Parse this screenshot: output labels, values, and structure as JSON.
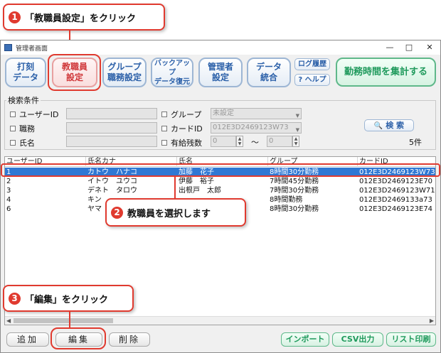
{
  "window": {
    "title": "管理者画面",
    "controls": [
      "—",
      "□",
      "✕"
    ]
  },
  "toolbar": {
    "clock_line1": "打刻",
    "clock_line2": "データ",
    "staff_line1": "教職員",
    "staff_line2": "設定",
    "group_line1": "グループ",
    "group_line2": "職務設定",
    "backup_line1": "バックアップ",
    "backup_line2": "データ復元",
    "admin_line1": "管理者",
    "admin_line2": "設定",
    "data_line1": "データ",
    "data_line2": "統合",
    "log_label": "ログ履歴",
    "help_label": "? ヘルプ",
    "aggregate_label": "勤務時間を集計する"
  },
  "search": {
    "legend": "検索条件",
    "user_id_label": "ユーザーID",
    "position_label": "職務",
    "name_label": "氏名",
    "group_label": "グループ",
    "group_value": "未設定",
    "card_label": "カードID",
    "card_value": "012E3D2469123W73",
    "leave_label": "有給残数",
    "leave_from": "0",
    "leave_sep": "〜",
    "leave_to": "0",
    "search_button": "検 索",
    "result_count": "5件"
  },
  "table": {
    "headers": [
      "ユーザーID",
      "氏名カナ",
      "氏名",
      "グループ",
      "カードID"
    ],
    "rows": [
      [
        "1",
        "カトウ　ハナコ",
        "加藤　花子",
        "8時間30分勤務",
        "012E3D2469123W73"
      ],
      [
        "2",
        "イトウ　ユウコ",
        "伊藤　裕子",
        "7時間45分勤務",
        "012E3D2469123E70"
      ],
      [
        "3",
        "デネト　タロウ",
        "出根戸　太郎",
        "7時間30分勤務",
        "012E3D2469123W71"
      ],
      [
        "4",
        "キン",
        "",
        "8時間勤務",
        "012E3D2469133a73"
      ],
      [
        "6",
        "ヤマ",
        "",
        "8時間30分勤務",
        "012E3D2469123E74"
      ]
    ]
  },
  "bottom": {
    "add": "追加",
    "edit": "編集",
    "delete": "削除",
    "import": "インポート",
    "csv": "CSV出力",
    "print": "リスト印刷"
  },
  "annotations": {
    "step1_num": "1",
    "step1_text": "「教職員設定」をクリック",
    "step2_num": "2",
    "step2_text": "教職員を選択します",
    "step3_num": "3",
    "step3_text": "「編集」をクリック"
  },
  "colors": {
    "accent_red": "#e03a2f",
    "selection_blue": "#2f78d4",
    "toolbar_blue": "#2a5fa8",
    "green": "#1f9a5c"
  }
}
